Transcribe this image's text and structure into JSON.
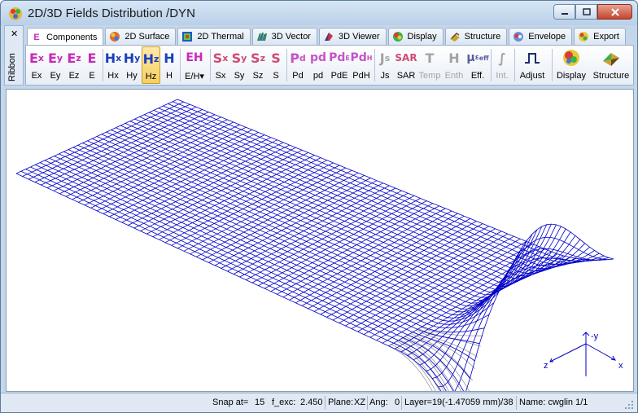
{
  "window": {
    "title": "2D/3D Fields Distribution /DYN",
    "minimize_icon": "minimize-icon",
    "maximize_icon": "maximize-icon",
    "close_icon": "close-icon"
  },
  "ribbon": {
    "side_label": "Ribbon",
    "close_glyph": "✕"
  },
  "tabs": [
    {
      "label": "Components",
      "icon": "E",
      "active": true
    },
    {
      "label": "2D Surface",
      "icon": "surface-icon"
    },
    {
      "label": "2D Thermal",
      "icon": "thermal-icon"
    },
    {
      "label": "3D Vector",
      "icon": "vector-icon"
    },
    {
      "label": "3D Viewer",
      "icon": "viewer-icon"
    },
    {
      "label": "Display",
      "icon": "display-icon"
    },
    {
      "label": "Structure",
      "icon": "structure-icon"
    },
    {
      "label": "Envelope",
      "icon": "envelope-icon"
    },
    {
      "label": "Export",
      "icon": "export-icon"
    }
  ],
  "toolbar": {
    "ex": {
      "label": "Ex",
      "glyph": "E",
      "sub": "x"
    },
    "ey": {
      "label": "Ey",
      "glyph": "E",
      "sub": "y"
    },
    "ez": {
      "label": "Ez",
      "glyph": "E",
      "sub": "z"
    },
    "e": {
      "label": "E",
      "glyph": "E"
    },
    "hx": {
      "label": "Hx",
      "glyph": "H",
      "sub": "x"
    },
    "hy": {
      "label": "Hy",
      "glyph": "H",
      "sub": "y"
    },
    "hz": {
      "label": "Hz",
      "glyph": "H",
      "sub": "z",
      "active": true
    },
    "h": {
      "label": "H",
      "glyph": "H"
    },
    "eh": {
      "label": "E/H",
      "glyph": "EH",
      "dropdown": "▾"
    },
    "sx": {
      "label": "Sx",
      "glyph": "S",
      "sub": "x"
    },
    "sy": {
      "label": "Sy",
      "glyph": "S",
      "sub": "y"
    },
    "sz": {
      "label": "Sz",
      "glyph": "S",
      "sub": "z"
    },
    "s": {
      "label": "S",
      "glyph": "S"
    },
    "pd_upper": {
      "label": "Pd",
      "glyph": "P",
      "sub": "d"
    },
    "pd_lower": {
      "label": "pd",
      "glyph": "pd"
    },
    "pde": {
      "label": "PdE",
      "glyph": "Pd",
      "sup": "E"
    },
    "pdh": {
      "label": "PdH",
      "glyph": "Pd",
      "sup": "H"
    },
    "js": {
      "label": "Js",
      "glyph": "J",
      "sub": "s"
    },
    "sar": {
      "label": "SAR",
      "glyph": "SAR"
    },
    "temp": {
      "label": "Temp",
      "glyph": "T"
    },
    "enth": {
      "label": "Enth",
      "glyph": "H"
    },
    "eff": {
      "label": "Eff.",
      "glyph": "μ",
      "sup": "ε",
      "sub": "eff"
    },
    "int": {
      "label": "Int.",
      "glyph": "∫"
    },
    "adjust": {
      "label": "Adjust"
    },
    "display": {
      "label": "Display"
    },
    "structure": {
      "label": "Structure"
    }
  },
  "axes": {
    "neg_y": "-y",
    "z": "z",
    "x": "x"
  },
  "status": {
    "snap_label": "Snap at=",
    "snap_value": "15",
    "fexc_label": "f_exc:",
    "fexc_value": "2.450",
    "plane_label": "Plane:",
    "plane_value": "XZ",
    "ang_label": "Ang:",
    "ang_value": "0",
    "layer": "Layer=19(-1.47059 mm)/38",
    "name": "Name: cwglin 1/1"
  },
  "colors": {
    "mesh": "#0000c8",
    "mesh_back": "#9a9a9a",
    "accent": "#c72bb8"
  }
}
